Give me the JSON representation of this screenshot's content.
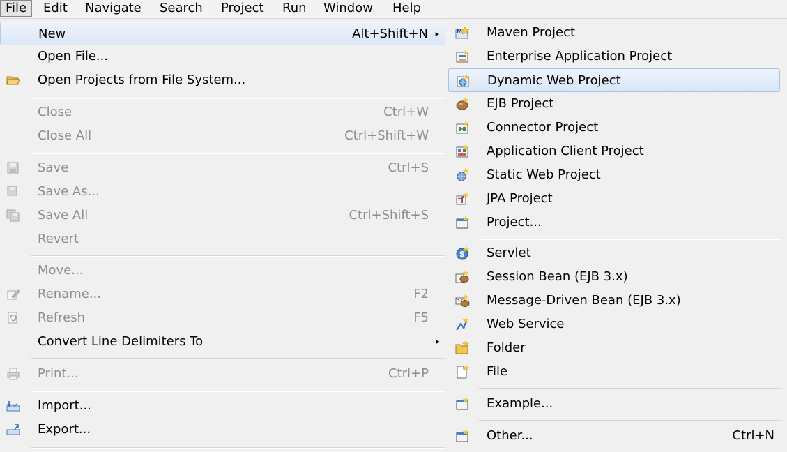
{
  "menubar": {
    "items": [
      "File",
      "Edit",
      "Navigate",
      "Search",
      "Project",
      "Run",
      "Window",
      "Help"
    ]
  },
  "file_menu": {
    "items": [
      {
        "label": "New",
        "accel": "Alt+Shift+N",
        "submenu": true,
        "icon": "none"
      },
      {
        "label": "Open File...",
        "accel": "",
        "icon": "none"
      },
      {
        "label": "Open Projects from File System...",
        "accel": "",
        "icon": "folder-open-icon"
      },
      {
        "label": "Close",
        "accel": "Ctrl+W",
        "disabled": true
      },
      {
        "label": "Close All",
        "accel": "Ctrl+Shift+W",
        "disabled": true
      },
      {
        "label": "Save",
        "accel": "Ctrl+S",
        "disabled": true,
        "icon": "save-icon"
      },
      {
        "label": "Save As...",
        "accel": "",
        "disabled": true,
        "icon": "save-as-icon"
      },
      {
        "label": "Save All",
        "accel": "Ctrl+Shift+S",
        "disabled": true,
        "icon": "save-all-icon"
      },
      {
        "label": "Revert",
        "accel": "",
        "disabled": true
      },
      {
        "label": "Move...",
        "accel": "",
        "disabled": true
      },
      {
        "label": "Rename...",
        "accel": "F2",
        "disabled": true,
        "icon": "rename-icon"
      },
      {
        "label": "Refresh",
        "accel": "F5",
        "disabled": true,
        "icon": "refresh-icon"
      },
      {
        "label": "Convert Line Delimiters To",
        "accel": "",
        "submenu": true
      },
      {
        "label": "Print...",
        "accel": "Ctrl+P",
        "disabled": true,
        "icon": "print-icon"
      },
      {
        "label": "Import...",
        "accel": "",
        "icon": "import-icon"
      },
      {
        "label": "Export...",
        "accel": "",
        "icon": "export-icon"
      }
    ]
  },
  "new_submenu": {
    "items": [
      {
        "label": "Maven Project",
        "icon": "maven-project-icon"
      },
      {
        "label": "Enterprise Application Project",
        "icon": "enterprise-app-project-icon"
      },
      {
        "label": "Dynamic Web Project",
        "icon": "dynamic-web-project-icon"
      },
      {
        "label": "EJB Project",
        "icon": "ejb-project-icon"
      },
      {
        "label": "Connector Project",
        "icon": "connector-project-icon"
      },
      {
        "label": "Application Client Project",
        "icon": "app-client-project-icon"
      },
      {
        "label": "Static Web Project",
        "icon": "static-web-project-icon"
      },
      {
        "label": "JPA Project",
        "icon": "jpa-project-icon"
      },
      {
        "label": "Project...",
        "icon": "project-icon"
      },
      {
        "label": "Servlet",
        "icon": "servlet-icon"
      },
      {
        "label": "Session Bean (EJB 3.x)",
        "icon": "session-bean-icon"
      },
      {
        "label": "Message-Driven Bean (EJB 3.x)",
        "icon": "message-driven-bean-icon"
      },
      {
        "label": "Web Service",
        "icon": "web-service-icon"
      },
      {
        "label": "Folder",
        "icon": "folder-icon"
      },
      {
        "label": "File",
        "icon": "file-icon"
      },
      {
        "label": "Example...",
        "icon": "example-icon"
      },
      {
        "label": "Other...",
        "accel": "Ctrl+N",
        "icon": "other-wizard-icon"
      }
    ]
  },
  "submenu_arrow": "▸"
}
